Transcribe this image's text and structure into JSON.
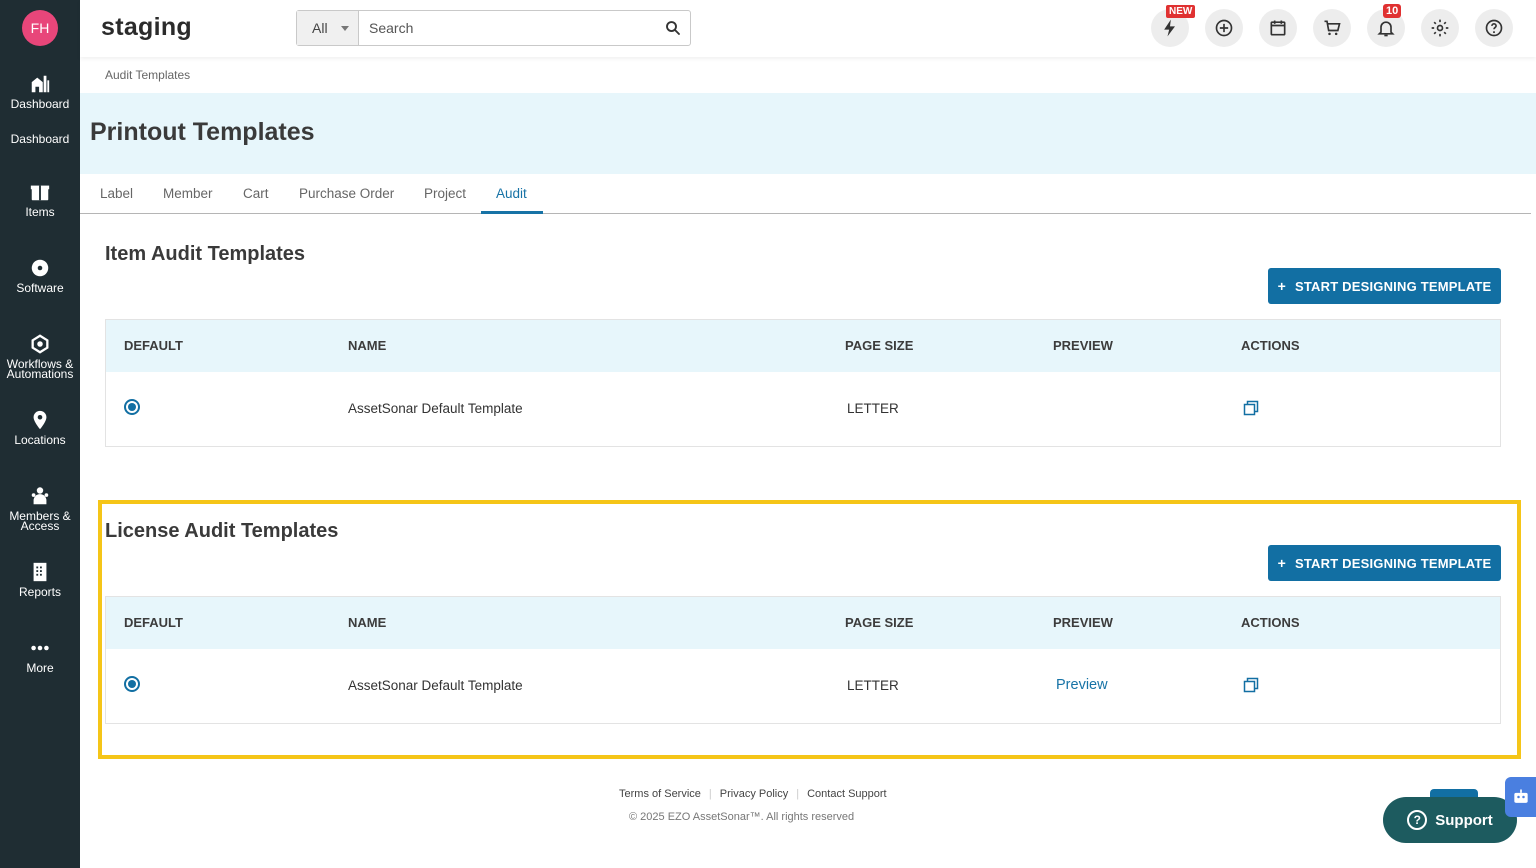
{
  "user": {
    "initials": "FH"
  },
  "sidebar": {
    "items": [
      {
        "label": "Dashboard",
        "icon": "dashboard-icon"
      },
      {
        "label": "Dashboard",
        "icon": ""
      },
      {
        "label": "Items",
        "icon": "items-icon"
      },
      {
        "label": "Software",
        "icon": "software-icon"
      },
      {
        "label": "Workflows &",
        "label2": "Automations",
        "icon": "workflows-icon"
      },
      {
        "label": "Locations",
        "icon": "location-pin-icon"
      },
      {
        "label": "Members &",
        "label2": "Access",
        "icon": "members-icon"
      },
      {
        "label": "Reports",
        "icon": "reports-icon"
      },
      {
        "label": "More",
        "icon": "more-dots-icon"
      }
    ]
  },
  "header": {
    "brand": "staging",
    "search": {
      "scope": "All",
      "placeholder": "Search"
    },
    "badges": {
      "new": "NEW",
      "notifications": "10"
    },
    "icons": [
      "lightning-icon",
      "add-circle-icon",
      "calendar-icon",
      "cart-icon",
      "bell-icon",
      "gear-icon",
      "help-icon"
    ]
  },
  "breadcrumb": "Audit Templates",
  "page_title": "Printout Templates",
  "tabs": [
    "Label",
    "Member",
    "Cart",
    "Purchase Order",
    "Project",
    "Audit"
  ],
  "active_tab": "Audit",
  "columns": [
    "DEFAULT",
    "NAME",
    "PAGE SIZE",
    "PREVIEW",
    "ACTIONS"
  ],
  "item_section": {
    "title": "Item Audit Templates",
    "button": "START DESIGNING TEMPLATE",
    "rows": [
      {
        "name": "AssetSonar Default Template",
        "page_size": "LETTER",
        "preview": ""
      }
    ]
  },
  "license_section": {
    "title": "License Audit Templates",
    "button": "START DESIGNING TEMPLATE",
    "rows": [
      {
        "name": "AssetSonar Default Template",
        "page_size": "LETTER",
        "preview": "Preview"
      }
    ]
  },
  "footer": {
    "links": [
      "Terms of Service",
      "Privacy Policy",
      "Contact Support"
    ],
    "copyright": "© 2025 EZO AssetSonar™. All rights reserved"
  },
  "support": {
    "label": "Support"
  },
  "colors": {
    "sidebar": "#1f2d33",
    "accent": "#126fa3",
    "highlight": "#f5c518",
    "avatar": "#e8467a"
  }
}
